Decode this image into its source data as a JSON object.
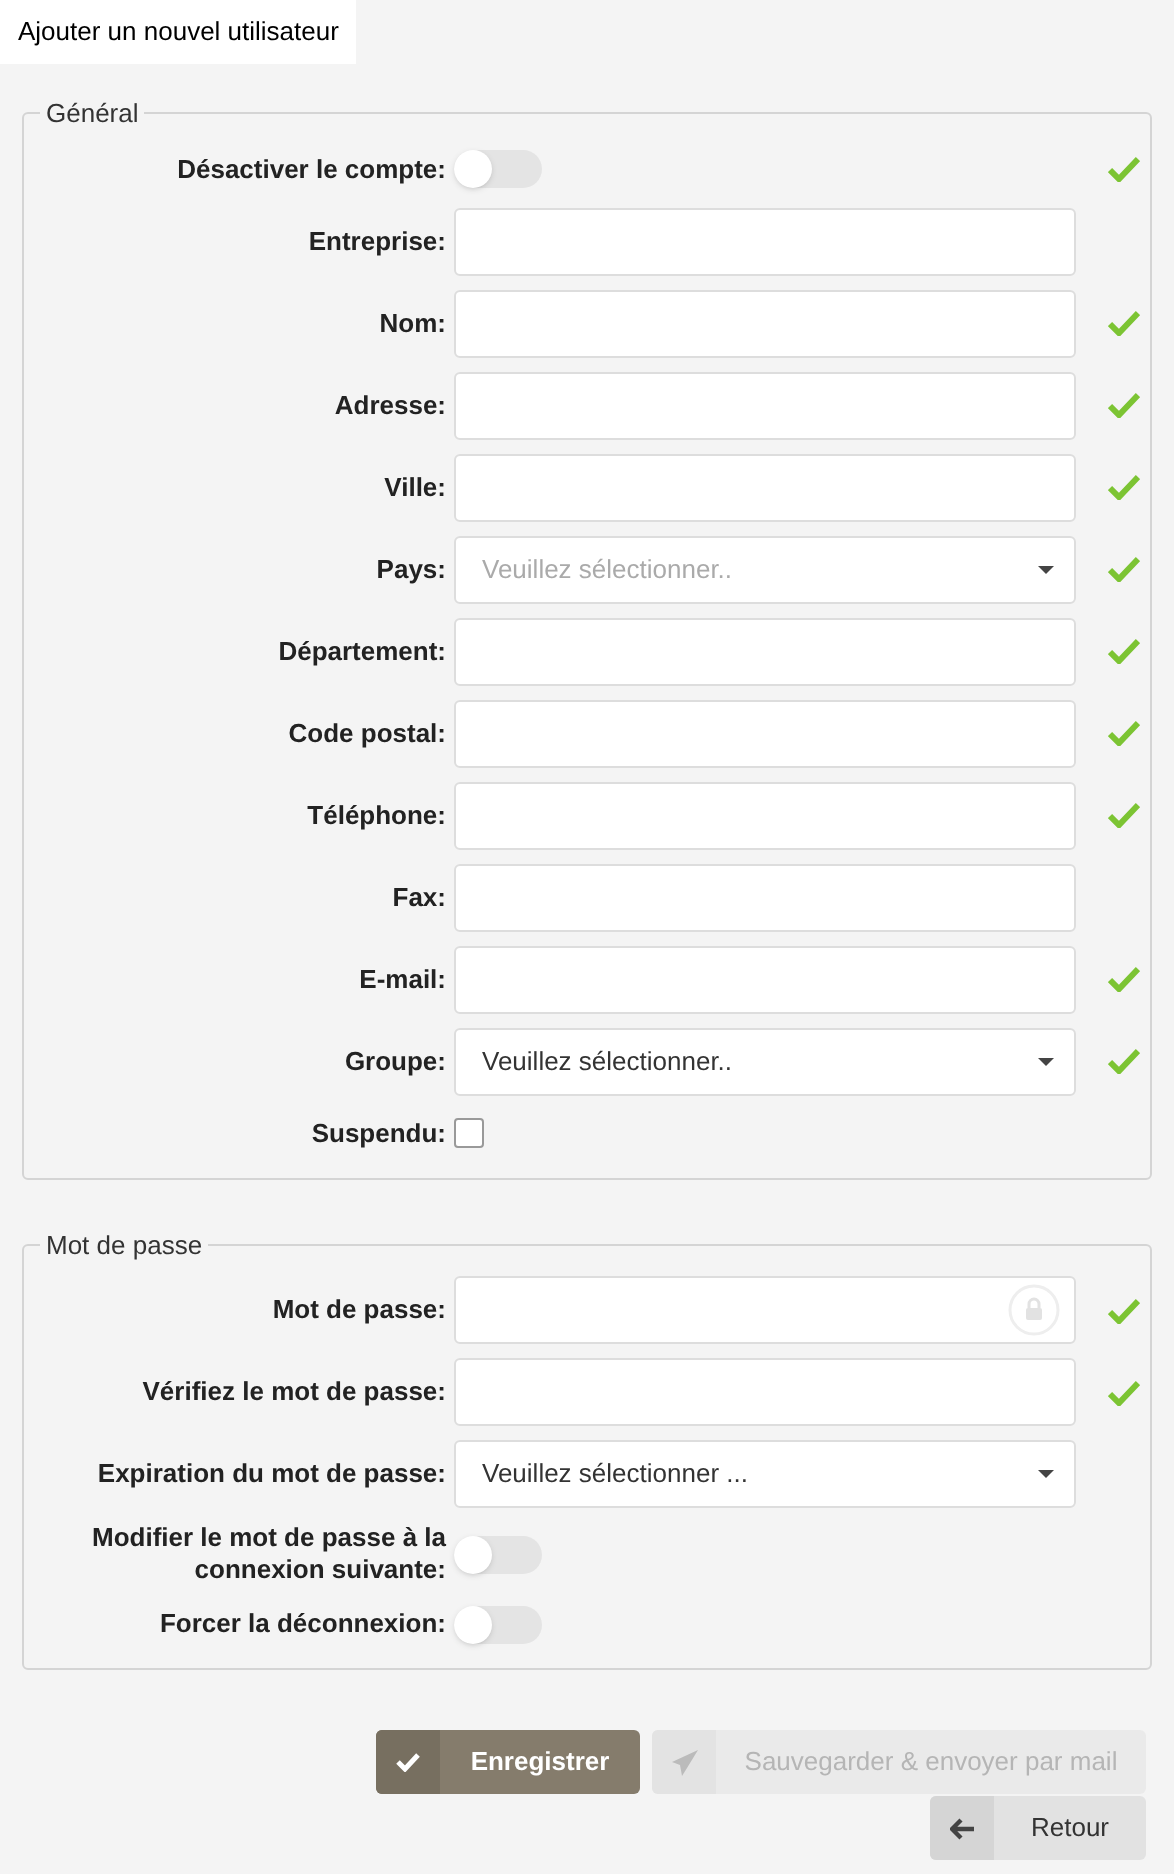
{
  "tab": {
    "label": "Ajouter un nouvel utilisateur",
    "selected": true
  },
  "sections": [
    {
      "legend": "Général",
      "fields": [
        {
          "kind": "toggle",
          "label": "Désactiver le compte:",
          "on": false,
          "valid": true
        },
        {
          "kind": "text",
          "label": "Entreprise:",
          "valid": false
        },
        {
          "kind": "text",
          "label": "Nom:",
          "valid": true
        },
        {
          "kind": "text",
          "label": "Adresse:",
          "valid": true
        },
        {
          "kind": "text",
          "label": "Ville:",
          "valid": true
        },
        {
          "kind": "select",
          "label": "Pays:",
          "placeholder": "Veuillez sélectionner..",
          "valid": true
        },
        {
          "kind": "text",
          "label": "Département:",
          "valid": true
        },
        {
          "kind": "text",
          "label": "Code postal:",
          "valid": true
        },
        {
          "kind": "text",
          "label": "Téléphone:",
          "valid": true
        },
        {
          "kind": "text",
          "label": "Fax:",
          "valid": false
        },
        {
          "kind": "text",
          "label": "E-mail:",
          "valid": true
        },
        {
          "kind": "select",
          "label": "Groupe:",
          "value": "Veuillez sélectionner..",
          "valid": true
        },
        {
          "kind": "checkbox",
          "label": "Suspendu:",
          "checked": false,
          "valid": false
        }
      ]
    },
    {
      "legend": "Mot de passe",
      "fields": [
        {
          "kind": "password",
          "label": "Mot de passe:",
          "valid": true
        },
        {
          "kind": "text",
          "label": "Vérifiez le mot de passe:",
          "valid": true
        },
        {
          "kind": "select",
          "label": "Expiration du mot de passe:",
          "value": "Veuillez sélectionner ...",
          "valid": false
        },
        {
          "kind": "toggle",
          "label": "Modifier le mot de passe à la connexion suivante:",
          "on": false,
          "valid": false
        },
        {
          "kind": "toggle",
          "label": "Forcer la déconnexion:",
          "on": false,
          "valid": false
        }
      ]
    }
  ],
  "buttons": [
    {
      "kind": "save",
      "label": "Enregistrer",
      "disabled": false
    },
    {
      "kind": "send",
      "label": "Sauvegarder & envoyer par mail",
      "disabled": true
    },
    {
      "kind": "back",
      "label": "Retour",
      "disabled": false
    }
  ]
}
